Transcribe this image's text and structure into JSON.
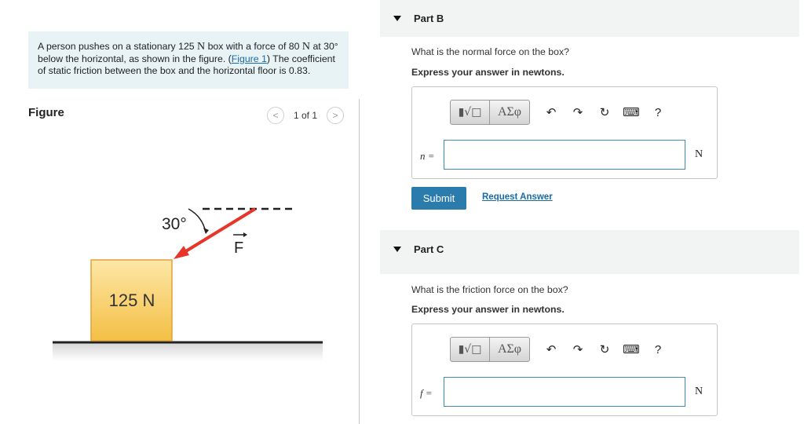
{
  "problem": {
    "text_1": "A person pushes on a stationary 125 ",
    "unit_n_1": "N",
    "text_2": " box with a force of 80 ",
    "unit_n_2": "N",
    "text_3": " at 30° below the horizontal, as shown in the figure. (",
    "figure_link": "Figure 1",
    "text_4": ") The coefficient of static friction between the box and the horizontal floor is 0.83."
  },
  "figure": {
    "title": "Figure",
    "pager_text": "1 of 1",
    "prev_symbol": "<",
    "next_symbol": ">",
    "box_label": "125 N",
    "angle_label": "30°",
    "force_label": "F",
    "colors": {
      "arrow": "#e8352a",
      "box_top": "#fde7a6",
      "box_bottom": "#f4bf45",
      "box_border": "#e0a23a"
    }
  },
  "parts": [
    {
      "title": "Part B",
      "question": "What is the normal force on the box?",
      "instruction": "Express your answer in newtons.",
      "variable": "n =",
      "value": "",
      "unit": "N",
      "submit_label": "Submit",
      "request_label": "Request Answer"
    },
    {
      "title": "Part C",
      "question": "What is the friction force on the box?",
      "instruction": "Express your answer in newtons.",
      "variable": "f =",
      "value": "",
      "unit": "N"
    }
  ],
  "toolbar": {
    "templates_icon": "templates-icon",
    "symbols_label": "ΑΣφ",
    "undo_icon": "undo-icon",
    "redo_icon": "redo-icon",
    "reset_icon": "reset-icon",
    "keyboard_icon": "keyboard-icon",
    "help_label": "?"
  },
  "colors": {
    "accent": "#2b7bac",
    "link": "#1a6aa6",
    "problem_bg": "#e8f3f6",
    "part_header_bg": "#f2f4f4"
  }
}
